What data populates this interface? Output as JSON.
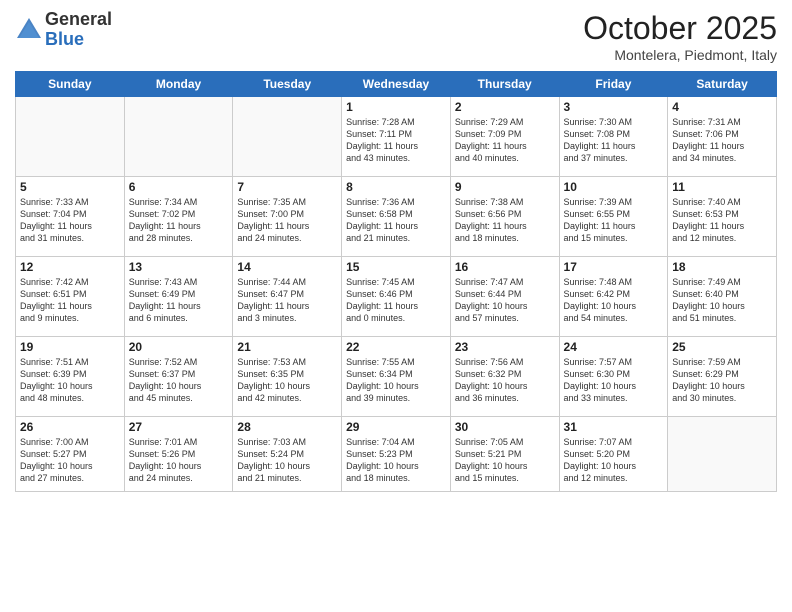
{
  "header": {
    "logo_line1": "General",
    "logo_line2": "Blue",
    "month_title": "October 2025",
    "location": "Montelera, Piedmont, Italy"
  },
  "weekdays": [
    "Sunday",
    "Monday",
    "Tuesday",
    "Wednesday",
    "Thursday",
    "Friday",
    "Saturday"
  ],
  "weeks": [
    [
      {
        "day": "",
        "info": ""
      },
      {
        "day": "",
        "info": ""
      },
      {
        "day": "",
        "info": ""
      },
      {
        "day": "1",
        "info": "Sunrise: 7:28 AM\nSunset: 7:11 PM\nDaylight: 11 hours\nand 43 minutes."
      },
      {
        "day": "2",
        "info": "Sunrise: 7:29 AM\nSunset: 7:09 PM\nDaylight: 11 hours\nand 40 minutes."
      },
      {
        "day": "3",
        "info": "Sunrise: 7:30 AM\nSunset: 7:08 PM\nDaylight: 11 hours\nand 37 minutes."
      },
      {
        "day": "4",
        "info": "Sunrise: 7:31 AM\nSunset: 7:06 PM\nDaylight: 11 hours\nand 34 minutes."
      }
    ],
    [
      {
        "day": "5",
        "info": "Sunrise: 7:33 AM\nSunset: 7:04 PM\nDaylight: 11 hours\nand 31 minutes."
      },
      {
        "day": "6",
        "info": "Sunrise: 7:34 AM\nSunset: 7:02 PM\nDaylight: 11 hours\nand 28 minutes."
      },
      {
        "day": "7",
        "info": "Sunrise: 7:35 AM\nSunset: 7:00 PM\nDaylight: 11 hours\nand 24 minutes."
      },
      {
        "day": "8",
        "info": "Sunrise: 7:36 AM\nSunset: 6:58 PM\nDaylight: 11 hours\nand 21 minutes."
      },
      {
        "day": "9",
        "info": "Sunrise: 7:38 AM\nSunset: 6:56 PM\nDaylight: 11 hours\nand 18 minutes."
      },
      {
        "day": "10",
        "info": "Sunrise: 7:39 AM\nSunset: 6:55 PM\nDaylight: 11 hours\nand 15 minutes."
      },
      {
        "day": "11",
        "info": "Sunrise: 7:40 AM\nSunset: 6:53 PM\nDaylight: 11 hours\nand 12 minutes."
      }
    ],
    [
      {
        "day": "12",
        "info": "Sunrise: 7:42 AM\nSunset: 6:51 PM\nDaylight: 11 hours\nand 9 minutes."
      },
      {
        "day": "13",
        "info": "Sunrise: 7:43 AM\nSunset: 6:49 PM\nDaylight: 11 hours\nand 6 minutes."
      },
      {
        "day": "14",
        "info": "Sunrise: 7:44 AM\nSunset: 6:47 PM\nDaylight: 11 hours\nand 3 minutes."
      },
      {
        "day": "15",
        "info": "Sunrise: 7:45 AM\nSunset: 6:46 PM\nDaylight: 11 hours\nand 0 minutes."
      },
      {
        "day": "16",
        "info": "Sunrise: 7:47 AM\nSunset: 6:44 PM\nDaylight: 10 hours\nand 57 minutes."
      },
      {
        "day": "17",
        "info": "Sunrise: 7:48 AM\nSunset: 6:42 PM\nDaylight: 10 hours\nand 54 minutes."
      },
      {
        "day": "18",
        "info": "Sunrise: 7:49 AM\nSunset: 6:40 PM\nDaylight: 10 hours\nand 51 minutes."
      }
    ],
    [
      {
        "day": "19",
        "info": "Sunrise: 7:51 AM\nSunset: 6:39 PM\nDaylight: 10 hours\nand 48 minutes."
      },
      {
        "day": "20",
        "info": "Sunrise: 7:52 AM\nSunset: 6:37 PM\nDaylight: 10 hours\nand 45 minutes."
      },
      {
        "day": "21",
        "info": "Sunrise: 7:53 AM\nSunset: 6:35 PM\nDaylight: 10 hours\nand 42 minutes."
      },
      {
        "day": "22",
        "info": "Sunrise: 7:55 AM\nSunset: 6:34 PM\nDaylight: 10 hours\nand 39 minutes."
      },
      {
        "day": "23",
        "info": "Sunrise: 7:56 AM\nSunset: 6:32 PM\nDaylight: 10 hours\nand 36 minutes."
      },
      {
        "day": "24",
        "info": "Sunrise: 7:57 AM\nSunset: 6:30 PM\nDaylight: 10 hours\nand 33 minutes."
      },
      {
        "day": "25",
        "info": "Sunrise: 7:59 AM\nSunset: 6:29 PM\nDaylight: 10 hours\nand 30 minutes."
      }
    ],
    [
      {
        "day": "26",
        "info": "Sunrise: 7:00 AM\nSunset: 5:27 PM\nDaylight: 10 hours\nand 27 minutes."
      },
      {
        "day": "27",
        "info": "Sunrise: 7:01 AM\nSunset: 5:26 PM\nDaylight: 10 hours\nand 24 minutes."
      },
      {
        "day": "28",
        "info": "Sunrise: 7:03 AM\nSunset: 5:24 PM\nDaylight: 10 hours\nand 21 minutes."
      },
      {
        "day": "29",
        "info": "Sunrise: 7:04 AM\nSunset: 5:23 PM\nDaylight: 10 hours\nand 18 minutes."
      },
      {
        "day": "30",
        "info": "Sunrise: 7:05 AM\nSunset: 5:21 PM\nDaylight: 10 hours\nand 15 minutes."
      },
      {
        "day": "31",
        "info": "Sunrise: 7:07 AM\nSunset: 5:20 PM\nDaylight: 10 hours\nand 12 minutes."
      },
      {
        "day": "",
        "info": ""
      }
    ]
  ]
}
